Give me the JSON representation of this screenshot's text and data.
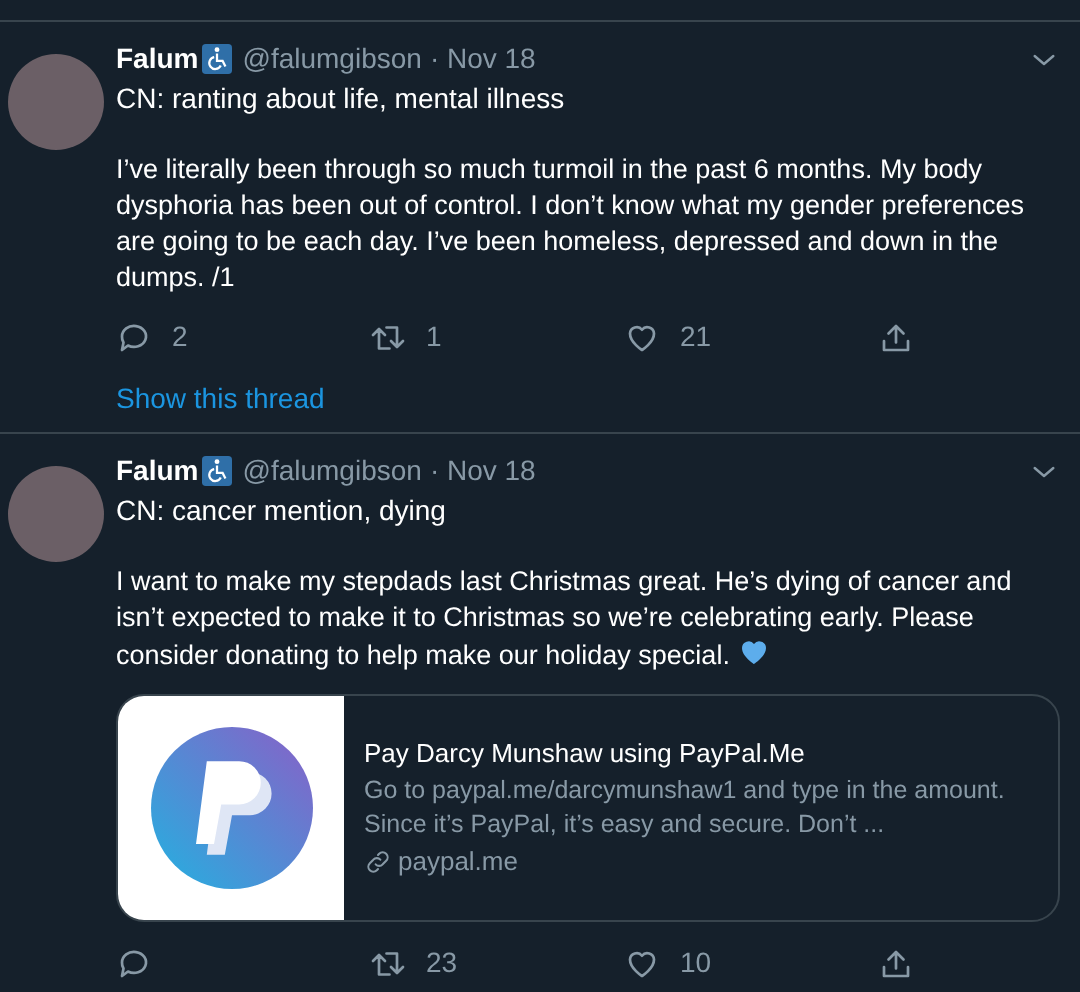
{
  "tweets": [
    {
      "name": "Falum",
      "handle": "@falumgibson",
      "date": "· Nov 18",
      "content_warning": "CN: ranting about life, mental illness",
      "body": "I’ve literally been through so much turmoil in the past 6 months. My body dysphoria has been out of control. I don’t know what my gender preferences are going to be each day. I’ve been homeless, depressed and down in the dumps. /1",
      "emoji": false,
      "replies": "2",
      "retweets": "1",
      "likes": "21",
      "show_thread": "Show this thread"
    },
    {
      "name": "Falum",
      "handle": "@falumgibson",
      "date": "· Nov 18",
      "content_warning": "CN: cancer mention, dying",
      "body": "I want to make my stepdads last Christmas great. He’s dying of cancer and isn’t expected to make it to Christmas so we’re celebrating early. Please consider donating to help make our holiday special.",
      "emoji": true,
      "card": {
        "title": "Pay Darcy Munshaw using PayPal.Me",
        "description": "Go to paypal.me/darcymunshaw1 and type in the amount. Since it’s PayPal, it’s easy and secure. Don’t ...",
        "domain": "paypal.me"
      },
      "retweets": "23",
      "likes": "10"
    }
  ]
}
